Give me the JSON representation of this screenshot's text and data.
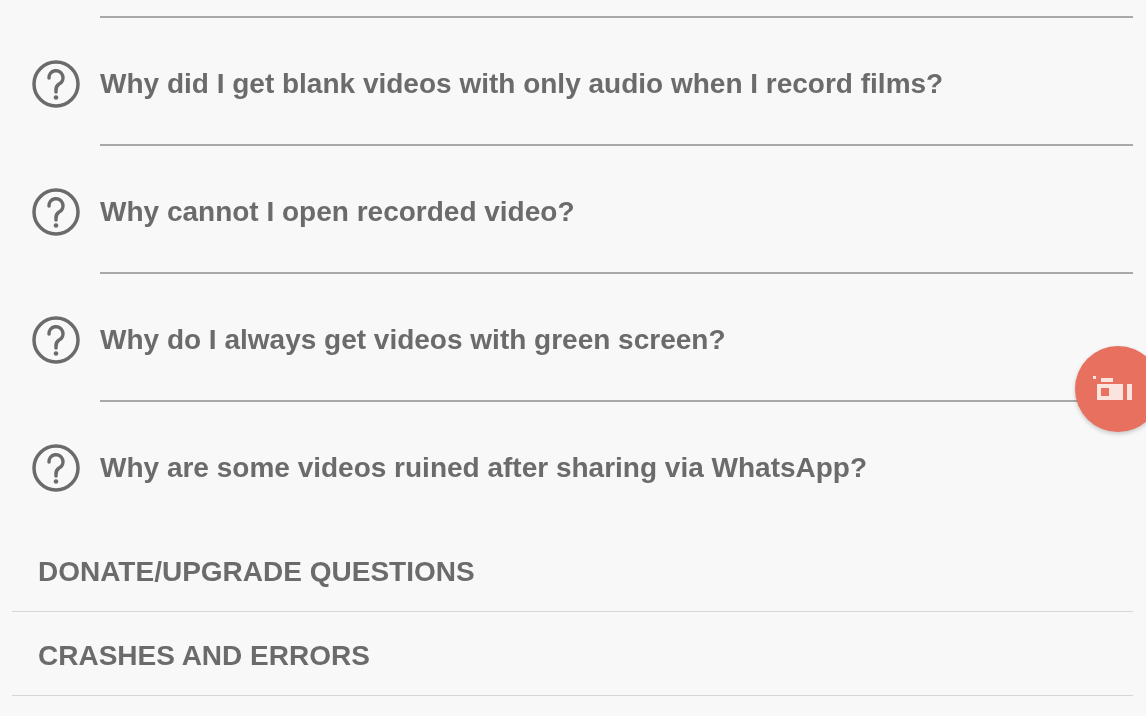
{
  "questions": [
    {
      "text": "Why did I get blank videos with only audio when I record films?"
    },
    {
      "text": "Why cannot I open recorded video?"
    },
    {
      "text": "Why do I always get videos with green screen?"
    },
    {
      "text": "Why are some videos ruined after sharing via WhatsApp?"
    }
  ],
  "sections": [
    {
      "title": "DONATE/UPGRADE QUESTIONS"
    },
    {
      "title": "CRASHES AND ERRORS"
    }
  ]
}
